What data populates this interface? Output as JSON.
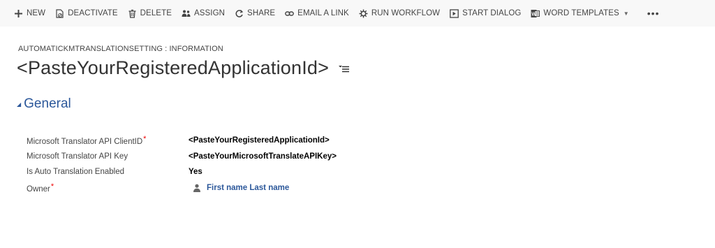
{
  "toolbar": {
    "new_label": "NEW",
    "deactivate_label": "DEACTIVATE",
    "delete_label": "DELETE",
    "assign_label": "ASSIGN",
    "share_label": "SHARE",
    "email_link_label": "EMAIL A LINK",
    "run_workflow_label": "RUN WORKFLOW",
    "start_dialog_label": "START DIALOG",
    "word_templates_label": "WORD TEMPLATES",
    "more_label": "•••"
  },
  "header": {
    "entity_label": "AUTOMATICKMTRANSLATIONSETTING : INFORMATION",
    "record_title": "<PasteYourRegisteredApplicationId>"
  },
  "section": {
    "title": "General",
    "fields": [
      {
        "label": "Microsoft Translator API ClientID",
        "required": true,
        "value": "<PasteYourRegisteredApplicationId>"
      },
      {
        "label": "Microsoft Translator API Key",
        "required": false,
        "value": "<PasteYourMicrosoftTranslateAPIKey>"
      },
      {
        "label": "Is Auto Translation Enabled",
        "required": false,
        "value": "Yes"
      },
      {
        "label": "Owner",
        "required": true,
        "value": "First name Last name"
      }
    ]
  },
  "required_marker": "*",
  "colors": {
    "accent": "#2b579a",
    "required": "#ee0000",
    "toolbar_bg": "#f8f8f8"
  }
}
